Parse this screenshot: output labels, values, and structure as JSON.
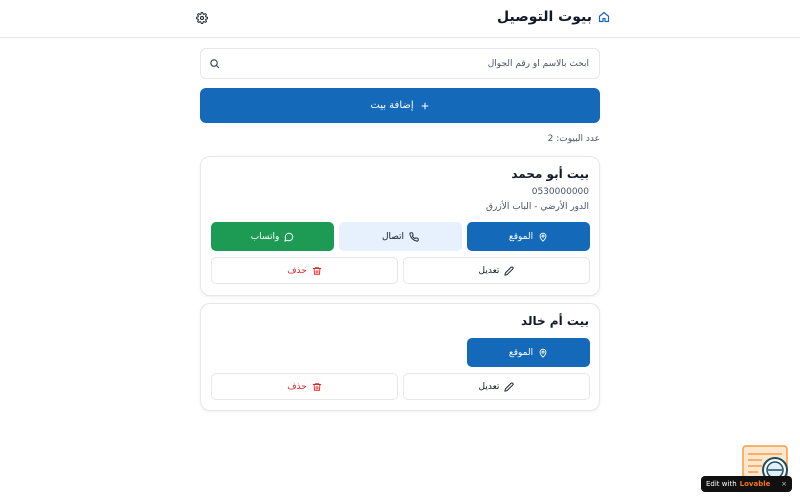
{
  "header": {
    "title": "بيوت التوصيل",
    "home_icon": "home-icon",
    "settings_icon": "gear-icon"
  },
  "search": {
    "placeholder": "ابحث بالاسم أو رقم الجوال",
    "value": ""
  },
  "add_button": {
    "label": "إضافة بيت",
    "icon": "plus-icon"
  },
  "count_label": "عدد البيوت: 2",
  "houses": [
    {
      "name": "بيت أبو محمد",
      "phone": "0530000000",
      "address": "الدور الأرضي - الباب الأزرق"
    },
    {
      "name": "بيت أم خالد"
    }
  ],
  "actions": {
    "location": "الموقع",
    "call": "اتصال",
    "whatsapp": "واتساب",
    "edit": "تعديل",
    "delete": "حذف"
  },
  "badge": {
    "prefix": "Edit with",
    "brand": "Lovable",
    "close": "×"
  },
  "colors": {
    "primary": "#1469b8",
    "whatsapp": "#1d9b55",
    "call_bg": "#e6f1fd",
    "danger": "#dc2626"
  }
}
